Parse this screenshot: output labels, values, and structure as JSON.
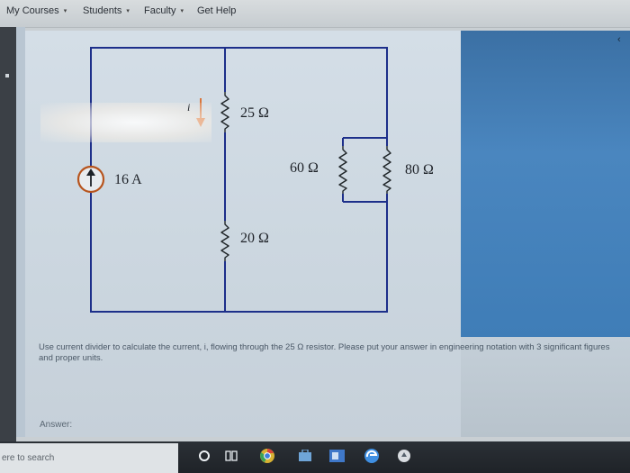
{
  "nav": {
    "items": [
      "My Courses",
      "Students",
      "Faculty",
      "Get Help"
    ],
    "caret": "▾"
  },
  "right_chevron": "‹",
  "circuit": {
    "current_source": "16 A",
    "current_label": "i",
    "r1": "25 Ω",
    "r2": "20 Ω",
    "r3": "60 Ω",
    "r4": "80 Ω"
  },
  "question": "Use current divider to calculate the current, i, flowing through the 25 Ω resistor. Please put your answer in engineering notation with 3 significant figures and proper units.",
  "answer_label": "Answer:",
  "taskbar": {
    "search_text": "ere to search",
    "icons": [
      "cortana-circle-icon",
      "task-view-icon",
      "chrome-icon",
      "store-icon",
      "outlook-icon",
      "edge-icon",
      "app-icon"
    ]
  },
  "colors": {
    "wire": "#1d2f8a",
    "resistor": "#1f2528",
    "current_arrow": "#d96a2a",
    "source_ring": "#b7541d",
    "taskbar": "#23272c"
  }
}
